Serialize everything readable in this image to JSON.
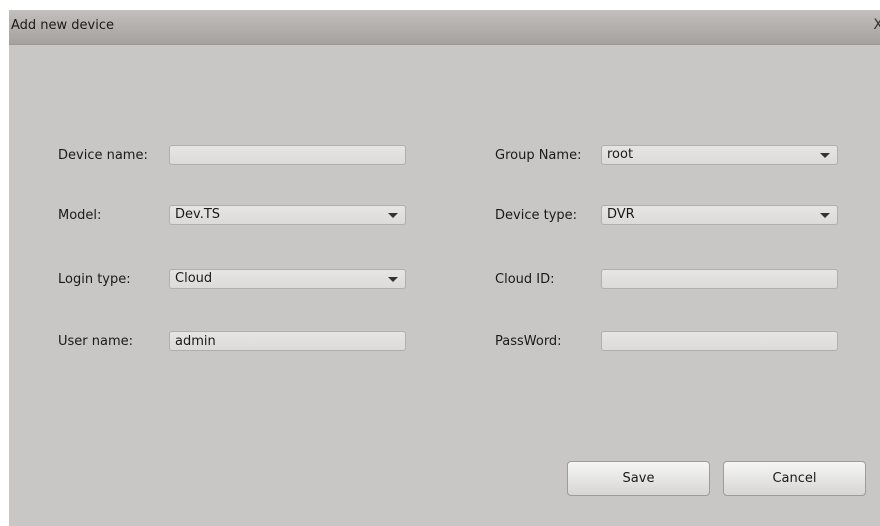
{
  "dialog": {
    "title": "Add new device",
    "close_glyph": "X"
  },
  "form": {
    "device_name": {
      "label": "Device name:",
      "value": ""
    },
    "model": {
      "label": "Model:",
      "value": "Dev.TS"
    },
    "login_type": {
      "label": "Login type:",
      "value": "Cloud"
    },
    "user_name": {
      "label": "User name:",
      "value": "admin"
    },
    "group_name": {
      "label": "Group Name:",
      "value": "root"
    },
    "device_type": {
      "label": "Device type:",
      "value": "DVR"
    },
    "cloud_id": {
      "label": "Cloud ID:",
      "value": ""
    },
    "password": {
      "label": "PassWord:",
      "value": ""
    }
  },
  "buttons": {
    "save": "Save",
    "cancel": "Cancel"
  }
}
